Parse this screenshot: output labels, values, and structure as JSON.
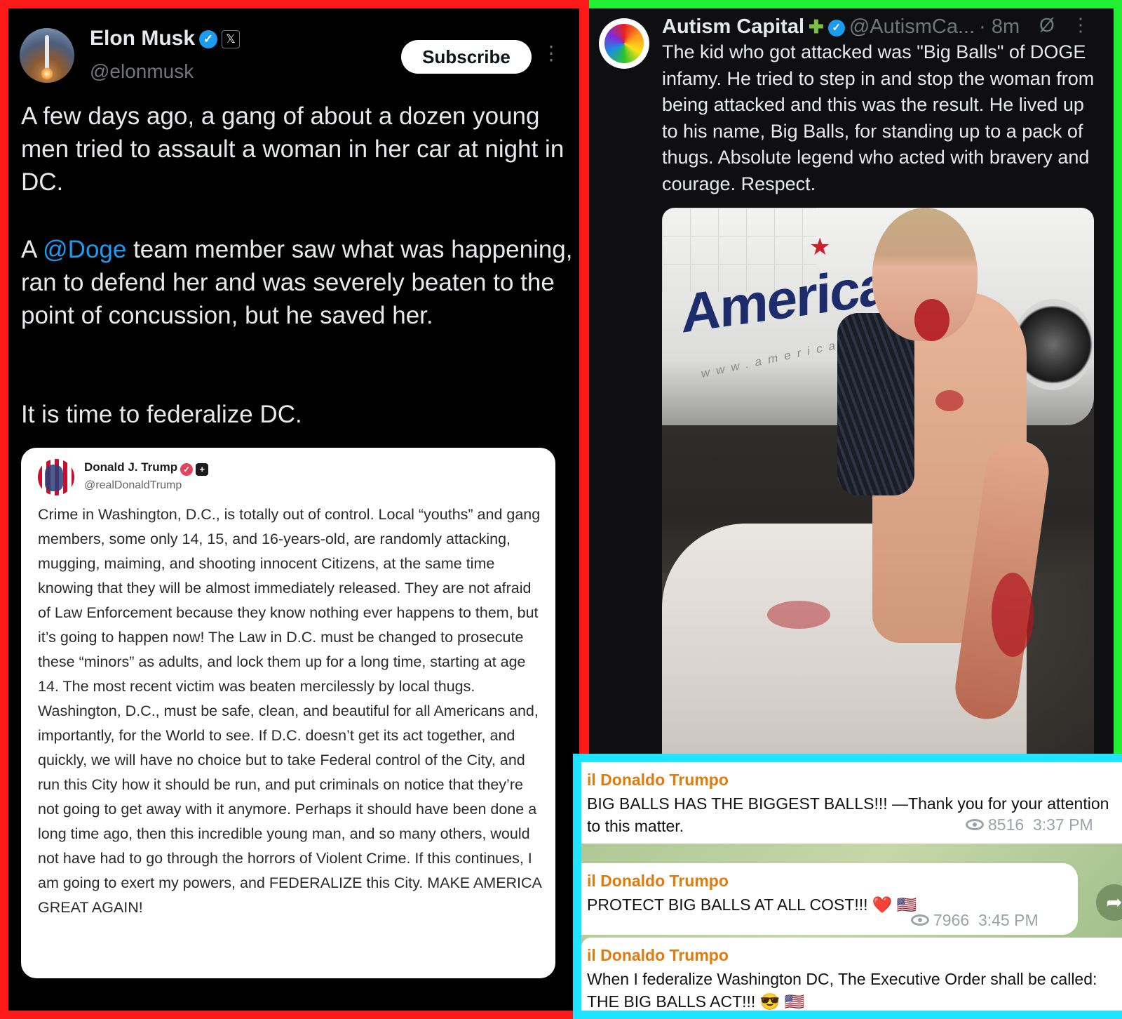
{
  "musk_post": {
    "name": "Elon Musk",
    "verified_icon": "verified-check-icon",
    "x_icon": "x-logo-icon",
    "handle": "@elonmusk",
    "subscribe_label": "Subscribe",
    "more_icon": "more-vertical-icon",
    "paragraph1": "A few days ago, a gang of about a dozen young men tried to assault a woman in her car at night in DC.",
    "paragraph2_prefix": "A ",
    "paragraph2_mention": "@Doge",
    "paragraph2_suffix": " team member saw what was happening, ran to defend her and was severely beaten to the point of concussion, but he saved her.",
    "paragraph3": "It is time to federalize DC."
  },
  "truth_post": {
    "name": "Donald J. Trump",
    "handle": "@realDonaldTrump",
    "text": "Crime in Washington, D.C., is totally out of control. Local “youths” and gang members, some only 14, 15, and 16-years-old, are randomly attacking, mugging, maiming, and shooting innocent Citizens, at the same time knowing that they will be almost immediately released. They are not afraid of Law Enforcement because they know nothing ever happens to them, but it’s going to happen now! The Law in D.C. must be changed to prosecute these “minors” as adults, and lock them up for a long time, starting at age 14. The most recent victim was beaten mercilessly by local thugs. Washington, D.C., must be safe, clean, and beautiful for all Americans and, importantly, for the World to see. If D.C. doesn’t get its act together, and quickly, we will have no choice but to take Federal control of the City, and run this City how it should be run, and put criminals on notice that they’re not going to get away with it anymore. Perhaps it should have been done a long time ago, then this incredible young man, and so many others, would not have had to go through the horrors of Violent Crime. If this continues, I am going to exert my powers, and FEDERALIZE this City. MAKE AMERICA GREAT AGAIN!"
  },
  "autism_post": {
    "name": "Autism Capital",
    "handle": "@AutismCa...",
    "time": "· 8m",
    "text": "The kid who got attacked was \"Big Balls\" of DOGE infamy. He tried to step in and stop the woman from being attacked and this was the result. He lived up to his name, Big Balls, for standing up to a pack of thugs. Absolute legend who acted with bravery and courage. Respect.",
    "photo_brand": "American",
    "photo_website": "www.america"
  },
  "telegram": {
    "messages": [
      {
        "author": "il Donaldo Trumpo",
        "text": "BIG BALLS HAS THE BIGGEST BALLS!!! —Thank you for your attention to this matter.",
        "views": "8516",
        "time": "3:37 PM"
      },
      {
        "author": "il Donaldo Trumpo",
        "text": "PROTECT BIG BALLS AT ALL COST!!! ❤️ 🇺🇸",
        "views": "7966",
        "time": "3:45 PM"
      },
      {
        "author": "il Donaldo Trumpo",
        "text": "When I federalize Washington DC, The Executive Order shall be called: THE BIG BALLS ACT!!! 😎 🇺🇸"
      }
    ]
  },
  "colors": {
    "left_border": "#ff1a1a",
    "right_top_border": "#22ee33",
    "right_bottom_border": "#1fe3ff",
    "x_blue": "#1d9bf0",
    "telegram_author": "#e07b0e"
  }
}
